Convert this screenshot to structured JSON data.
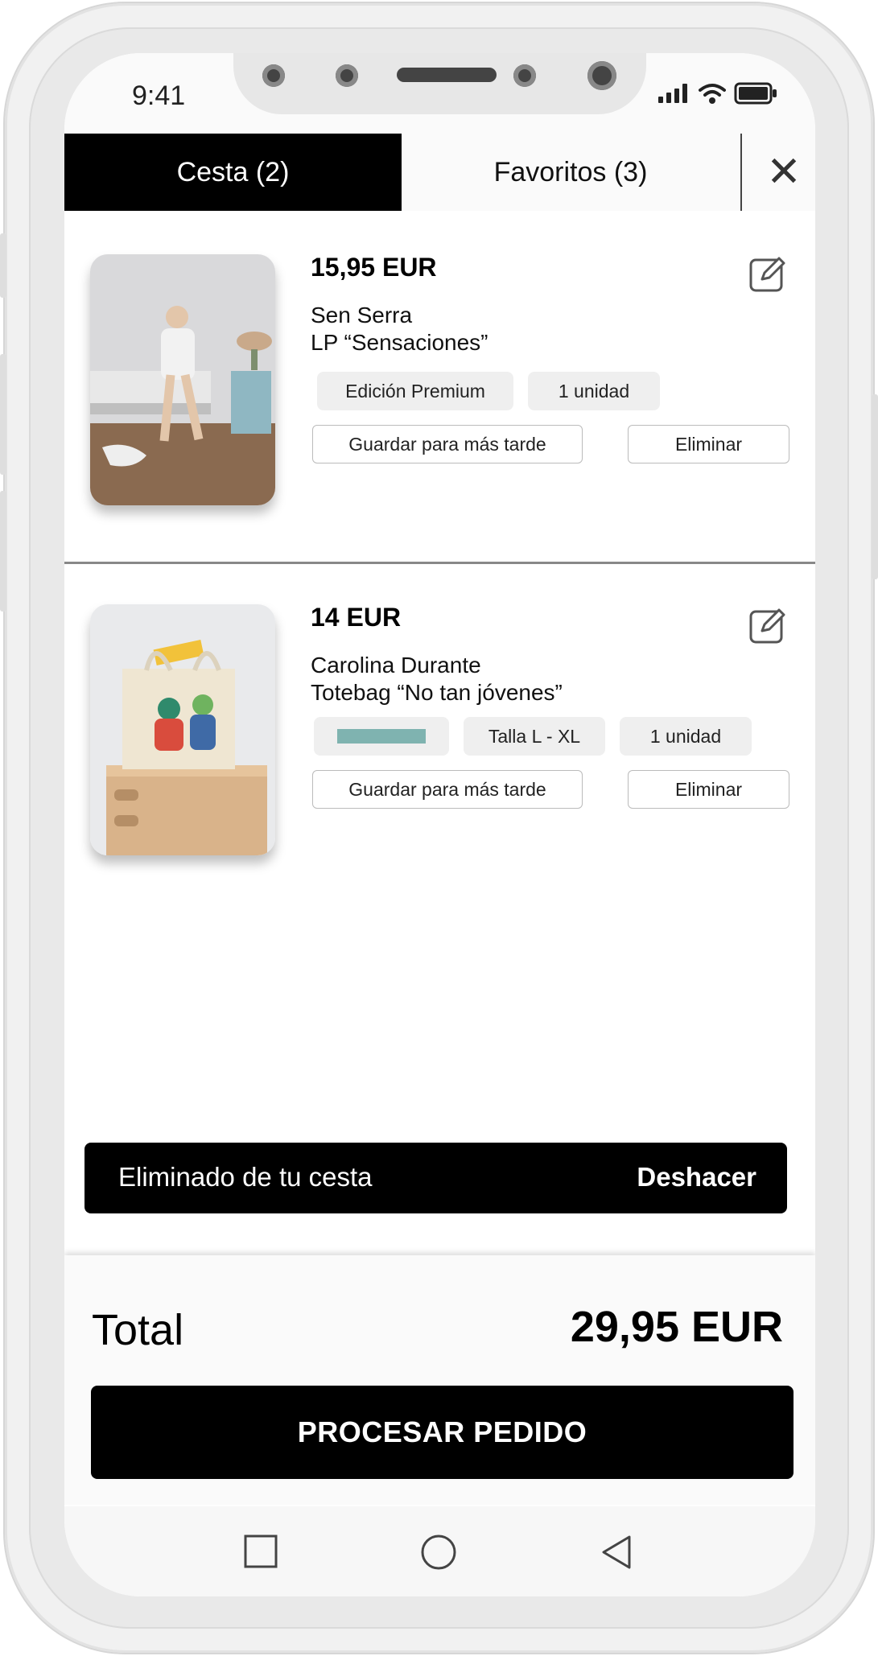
{
  "status_bar": {
    "time": "9:41"
  },
  "tabs": [
    {
      "label": "Cesta (2)",
      "active": true
    },
    {
      "label": "Favoritos (3)",
      "active": false
    }
  ],
  "close_icon": "close-icon",
  "cart_items": [
    {
      "price": "15,95 EUR",
      "artist": "Sen Serra",
      "product": "LP “Sensaciones”",
      "options": [
        "Edición Premium",
        "1 unidad"
      ],
      "save_label": "Guardar para más tarde",
      "remove_label": "Eliminar"
    },
    {
      "price": "14 EUR",
      "artist": "Carolina Durante",
      "product": "Totebag “No tan jóvenes”",
      "color_swatch": "#7fb3b0",
      "options": [
        "Talla L - XL",
        "1 unidad"
      ],
      "save_label": "Guardar para más tarde",
      "remove_label": "Eliminar"
    }
  ],
  "toast": {
    "message": "Eliminado de tu cesta",
    "action": "Deshacer"
  },
  "summary": {
    "total_label": "Total",
    "total_value": "29,95 EUR"
  },
  "checkout_label": "PROCESAR PEDIDO",
  "nav_icons": [
    "square-icon",
    "circle-icon",
    "triangle-back-icon"
  ]
}
